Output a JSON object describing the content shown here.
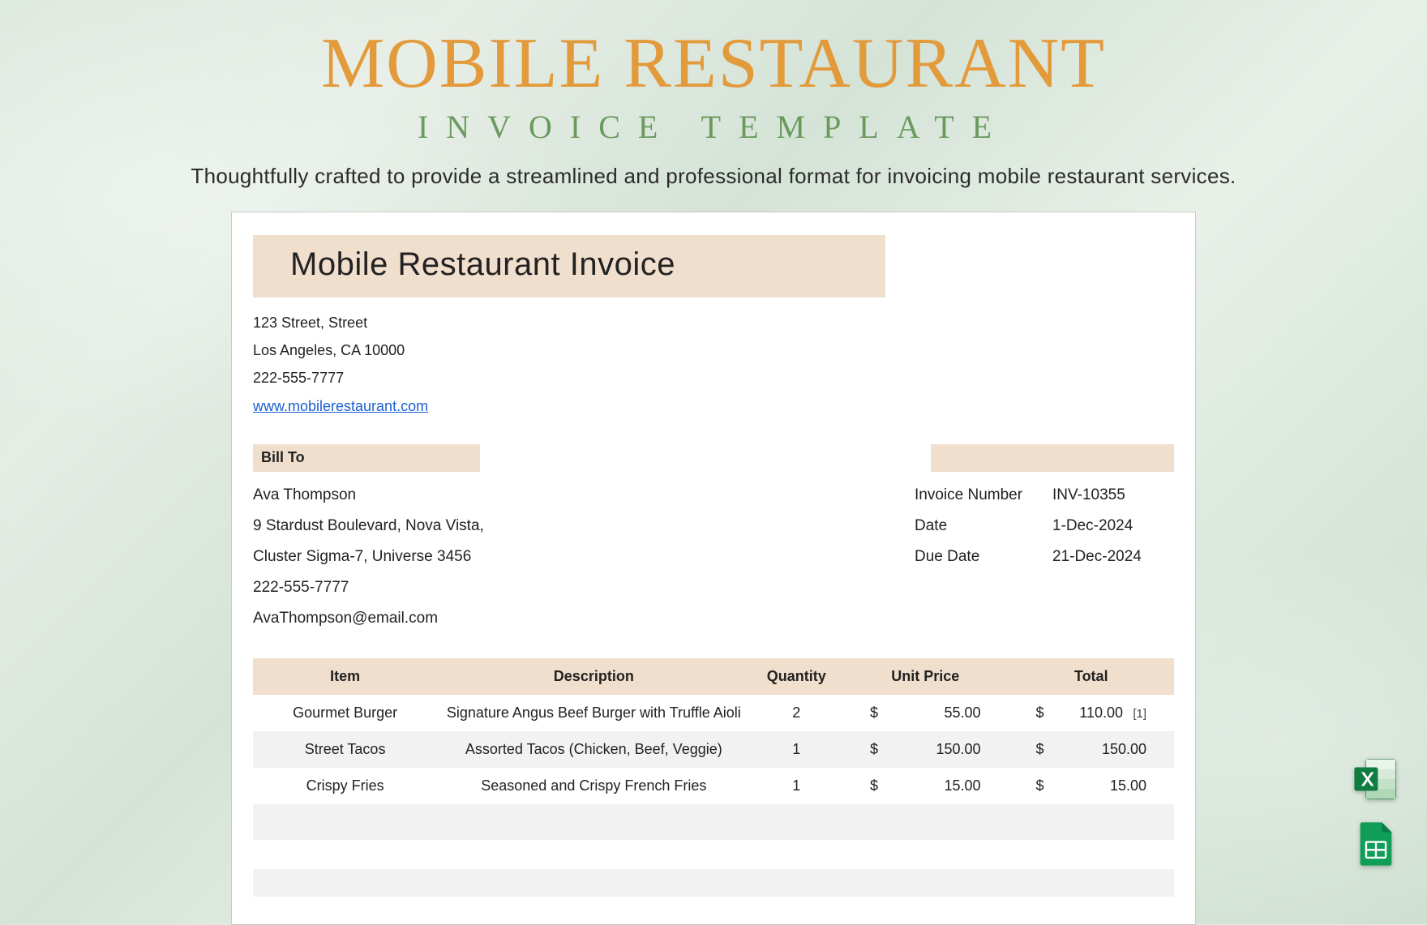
{
  "header": {
    "title": "MOBILE RESTAURANT",
    "subtitle": "INVOICE TEMPLATE",
    "tagline": "Thoughtfully crafted to provide a streamlined and professional format for invoicing mobile restaurant services."
  },
  "invoice": {
    "title": "Mobile Restaurant Invoice",
    "company": {
      "address1": "123 Street, Street",
      "address2": "Los Angeles, CA 10000",
      "phone": "222-555-7777",
      "website": "www.mobilerestaurant.com"
    },
    "bill_to_label": "Bill To",
    "bill_to": {
      "name": "Ava Thompson",
      "address1": "9 Stardust Boulevard, Nova Vista,",
      "address2": "Cluster Sigma-7, Universe 3456",
      "phone": "222-555-7777",
      "email": "AvaThompson@email.com"
    },
    "meta": {
      "invoice_number_label": "Invoice Number",
      "invoice_number": "INV-10355",
      "date_label": "Date",
      "date": "1-Dec-2024",
      "due_date_label": "Due Date",
      "due_date": "21-Dec-2024"
    },
    "columns": {
      "item": "Item",
      "description": "Description",
      "quantity": "Quantity",
      "unit_price": "Unit Price",
      "total": "Total"
    },
    "currency": "$",
    "line_items": [
      {
        "item": "Gourmet Burger",
        "description": "Signature Angus Beef Burger with Truffle Aioli",
        "quantity": "2",
        "unit_price": "55.00",
        "total": "110.00",
        "note_ref": "[1]"
      },
      {
        "item": "Street Tacos",
        "description": "Assorted Tacos (Chicken, Beef, Veggie)",
        "quantity": "1",
        "unit_price": "150.00",
        "total": "150.00",
        "note_ref": ""
      },
      {
        "item": "Crispy Fries",
        "description": "Seasoned and Crispy French Fries",
        "quantity": "1",
        "unit_price": "15.00",
        "total": "15.00",
        "note_ref": ""
      }
    ]
  },
  "icons": {
    "excel": "excel-icon",
    "sheets": "google-sheets-icon"
  }
}
